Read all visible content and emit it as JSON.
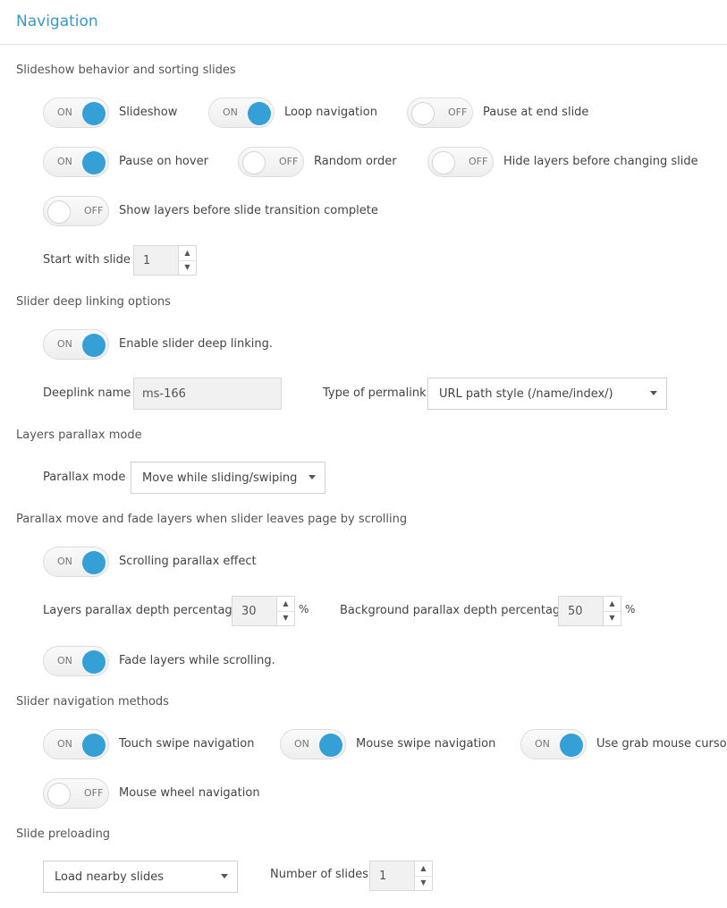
{
  "page_title": "Navigation",
  "sections": {
    "slideshow": "Slideshow behavior and sorting slides",
    "deeplink": "Slider deep linking options",
    "layers_parallax": "Layers parallax mode",
    "scroll_parallax": "Parallax move and fade layers when slider leaves page by scrolling",
    "nav_methods": "Slider navigation methods",
    "preloading": "Slide preloading"
  },
  "toggles": {
    "slideshow": {
      "state": "ON",
      "label": "Slideshow"
    },
    "loop": {
      "state": "ON",
      "label": "Loop navigation"
    },
    "pause_end": {
      "state": "OFF",
      "label": "Pause at end slide"
    },
    "pause_hover": {
      "state": "ON",
      "label": "Pause on hover"
    },
    "random": {
      "state": "OFF",
      "label": "Random order"
    },
    "hide_layers": {
      "state": "OFF",
      "label": "Hide layers before changing slide"
    },
    "show_layers": {
      "state": "OFF",
      "label": "Show layers before slide transition complete"
    },
    "deeplink": {
      "state": "ON",
      "label": "Enable slider deep linking."
    },
    "scroll_parallax": {
      "state": "ON",
      "label": "Scrolling parallax effect"
    },
    "fade_layers": {
      "state": "ON",
      "label": "Fade layers while scrolling."
    },
    "touch_swipe": {
      "state": "ON",
      "label": "Touch swipe navigation"
    },
    "mouse_swipe": {
      "state": "ON",
      "label": "Mouse swipe navigation"
    },
    "grab_cursor": {
      "state": "ON",
      "label": "Use grab mouse cursor"
    },
    "mouse_wheel": {
      "state": "OFF",
      "label": "Mouse wheel navigation"
    }
  },
  "fields": {
    "start_slide": {
      "label": "Start with slide :",
      "value": "1"
    },
    "deeplink_name": {
      "label": "Deeplink name :",
      "value": "ms-166"
    },
    "permalink": {
      "label": "Type of permalink:",
      "value": "URL path style (/name/index/)"
    },
    "parallax_mode": {
      "label": "Parallax mode :",
      "value": "Move while sliding/swiping"
    },
    "layers_depth": {
      "label": "Layers parallax depth percentage :",
      "value": "30",
      "unit": "%"
    },
    "bg_depth": {
      "label": "Background parallax depth percentage :",
      "value": "50",
      "unit": "%"
    },
    "preload_mode": {
      "value": "Load nearby slides"
    },
    "num_slides": {
      "label": "Number of slides :",
      "value": "1"
    }
  },
  "icons": {
    "spin_up": "▲",
    "spin_down": "▼"
  },
  "colors": {
    "accent": "#34a0d6",
    "title": "#3c97c6"
  }
}
